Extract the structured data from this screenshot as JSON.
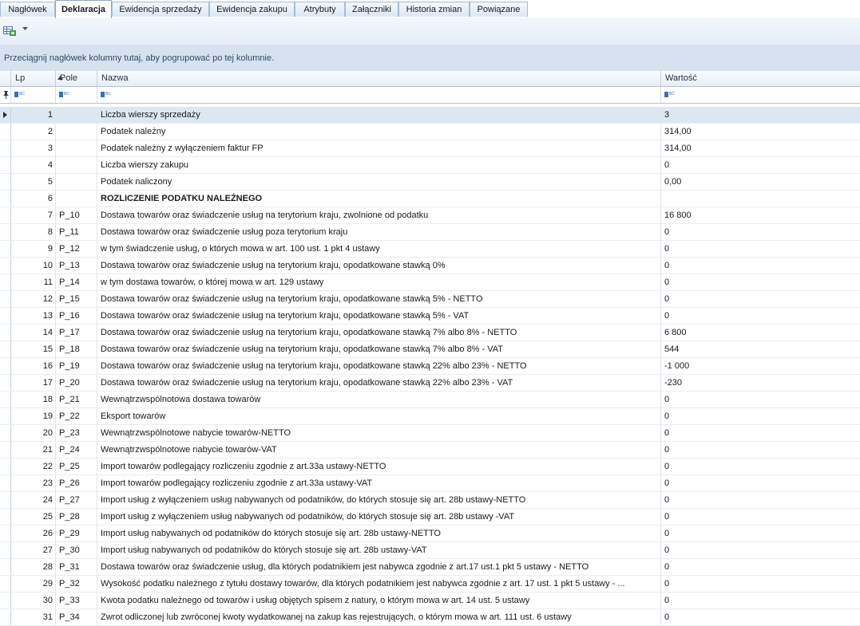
{
  "tabs": [
    {
      "label": "Nagłówek",
      "active": false
    },
    {
      "label": "Deklaracja",
      "active": true
    },
    {
      "label": "Ewidencja sprzedaży",
      "active": false
    },
    {
      "label": "Ewidencja zakupu",
      "active": false
    },
    {
      "label": "Atrybuty",
      "active": false
    },
    {
      "label": "Załączniki",
      "active": false
    },
    {
      "label": "Historia zmian",
      "active": false
    },
    {
      "label": "Powiązane",
      "active": false
    }
  ],
  "group_panel": {
    "text": "Przeciągnij nagłówek kolumny tutaj, aby pogrupować po tej kolumnie."
  },
  "columns": {
    "lp": "Lp",
    "pole": "Pole",
    "nazwa": "Nazwa",
    "wartosc": "Wartość"
  },
  "rows": [
    {
      "lp": "1",
      "pole": "",
      "nazwa": "Liczba wierszy sprzedaży",
      "wartosc": "3"
    },
    {
      "lp": "2",
      "pole": "",
      "nazwa": "Podatek należny",
      "wartosc": "314,00"
    },
    {
      "lp": "3",
      "pole": "",
      "nazwa": "Podatek należny z wyłączeniem faktur FP",
      "wartosc": "314,00"
    },
    {
      "lp": "4",
      "pole": "",
      "nazwa": "Liczba wierszy zakupu",
      "wartosc": "0"
    },
    {
      "lp": "5",
      "pole": "",
      "nazwa": "Podatek naliczony",
      "wartosc": "0,00"
    },
    {
      "lp": "6",
      "pole": "",
      "nazwa": "ROZLICZENIE PODATKU NALEŻNEGO",
      "wartosc": ""
    },
    {
      "lp": "7",
      "pole": "P_10",
      "nazwa": "Dostawa towarów oraz świadczenie usług na terytorium kraju, zwolnione od podatku",
      "wartosc": "16 800"
    },
    {
      "lp": "8",
      "pole": "P_11",
      "nazwa": "Dostawa towarów oraz świadczenie usług poza terytorium kraju",
      "wartosc": "0"
    },
    {
      "lp": "9",
      "pole": "P_12",
      "nazwa": "w tym świadczenie usług, o których mowa w art. 100 ust. 1 pkt 4 ustawy",
      "wartosc": "0"
    },
    {
      "lp": "10",
      "pole": "P_13",
      "nazwa": "Dostawa towarów oraz świadczenie usług na terytorium kraju, opodatkowane stawką 0%",
      "wartosc": "0"
    },
    {
      "lp": "11",
      "pole": "P_14",
      "nazwa": "w tym dostawa towarów, o której mowa w art. 129 ustawy",
      "wartosc": "0"
    },
    {
      "lp": "12",
      "pole": "P_15",
      "nazwa": "Dostawa towarów oraz świadczenie usług na terytorium kraju,   opodatkowane stawką 5% - NETTO",
      "wartosc": "0"
    },
    {
      "lp": "13",
      "pole": "P_16",
      "nazwa": "Dostawa towarów oraz świadczenie usług na terytorium kraju,   opodatkowane stawką  5% - VAT",
      "wartosc": "0"
    },
    {
      "lp": "14",
      "pole": "P_17",
      "nazwa": "Dostawa towarów oraz świadczenie usług na terytorium kraju, opodatkowane stawką 7% albo 8% - NETTO",
      "wartosc": "6 800"
    },
    {
      "lp": "15",
      "pole": "P_18",
      "nazwa": "Dostawa towarów oraz świadczenie usług na terytorium kraju,   opodatkowane stawką 7% albo 8%  - VAT",
      "wartosc": "544"
    },
    {
      "lp": "16",
      "pole": "P_19",
      "nazwa": "Dostawa towarów oraz świadczenie usług na terytorium kraju,    opodatkowane stawką 22% albo 23% - NETTO",
      "wartosc": "-1 000"
    },
    {
      "lp": "17",
      "pole": "P_20",
      "nazwa": "Dostawa towarów oraz świadczenie usług na terytorium kraju,    opodatkowane stawką 22% albo 23% - VAT",
      "wartosc": "-230"
    },
    {
      "lp": "18",
      "pole": "P_21",
      "nazwa": "Wewnątrzwspólnotowa dostawa towarów",
      "wartosc": "0"
    },
    {
      "lp": "19",
      "pole": "P_22",
      "nazwa": "Eksport towarów",
      "wartosc": "0"
    },
    {
      "lp": "20",
      "pole": "P_23",
      "nazwa": "Wewnątrzwspólnotowe nabycie towarów-NETTO",
      "wartosc": "0"
    },
    {
      "lp": "21",
      "pole": "P_24",
      "nazwa": "Wewnątrzwspólnotowe nabycie towarów-VAT",
      "wartosc": "0"
    },
    {
      "lp": "22",
      "pole": "P_25",
      "nazwa": "Import towarów podlegający rozliczeniu zgodnie z art.33a ustawy-NETTO",
      "wartosc": "0"
    },
    {
      "lp": "23",
      "pole": "P_26",
      "nazwa": "Import towarów podlegający rozliczeniu zgodnie z art.33a ustawy-VAT",
      "wartosc": "0"
    },
    {
      "lp": "24",
      "pole": "P_27",
      "nazwa": "Import usług z wyłączeniem usług nabywanych od podatników, do których stosuje się art. 28b ustawy-NETTO",
      "wartosc": "0"
    },
    {
      "lp": "25",
      "pole": "P_28",
      "nazwa": "Import usług  z wyłączeniem usług nabywanych od podatników, do których stosuje się art. 28b ustawy -VAT",
      "wartosc": "0"
    },
    {
      "lp": "26",
      "pole": "P_29",
      "nazwa": "Import usług nabywanych od podatników do których stosuje się art. 28b ustawy-NETTO",
      "wartosc": "0"
    },
    {
      "lp": "27",
      "pole": "P_30",
      "nazwa": "Import usług nabywanych od podatników do których stosuje się art. 28b ustawy-VAT",
      "wartosc": "0"
    },
    {
      "lp": "28",
      "pole": "P_31",
      "nazwa": "Dostawa towarów oraz świadczenie usług, dla których podatnikiem jest nabywca zgodnie z art.17 ust.1 pkt 5 ustawy  - NETTO",
      "wartosc": "0"
    },
    {
      "lp": "29",
      "pole": "P_32",
      "nazwa": "Wysokość podatku należnego z tytułu dostawy towarów, dla których podatnikiem jest nabywca zgodnie z art. 17 ust. 1 pkt 5 ustawy - ...",
      "wartosc": "0"
    },
    {
      "lp": "30",
      "pole": "P_33",
      "nazwa": "Kwota podatku należnego od towarów i usług objętych spisem z natury, o którym mowa w art. 14 ust. 5 ustawy",
      "wartosc": "0"
    },
    {
      "lp": "31",
      "pole": "P_34",
      "nazwa": "Zwrot odliczonej lub zwróconej kwoty wydatkowanej na zakup kas rejestrujących, o którym mowa w art. 111 ust. 6 ustawy",
      "wartosc": "0"
    }
  ]
}
